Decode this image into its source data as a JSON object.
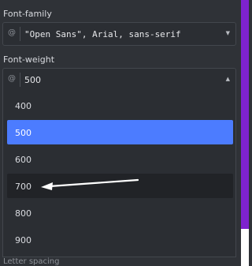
{
  "font_family": {
    "label": "Font-family",
    "prefix_icon": "at-sign-icon",
    "value": "\"Open Sans\", Arial, sans-serif",
    "caret_icon": "caret-down-icon"
  },
  "font_weight": {
    "label": "Font-weight",
    "prefix_icon": "at-sign-icon",
    "value": "500",
    "caret_icon": "caret-up-icon",
    "options": [
      "400",
      "500",
      "600",
      "700",
      "800",
      "900"
    ],
    "selected_option": "500",
    "hovered_option": "700"
  },
  "annotation": {
    "type": "arrow",
    "color": "#ffffff",
    "points_to": "700"
  },
  "next_section": {
    "label": "Letter spacing"
  },
  "colors": {
    "panel_bg": "#2f3237",
    "field_bg": "#2b2e33",
    "selected_bg": "#4c7cff",
    "hover_bg": "#212327",
    "accent_strip": "#7e22ce"
  }
}
